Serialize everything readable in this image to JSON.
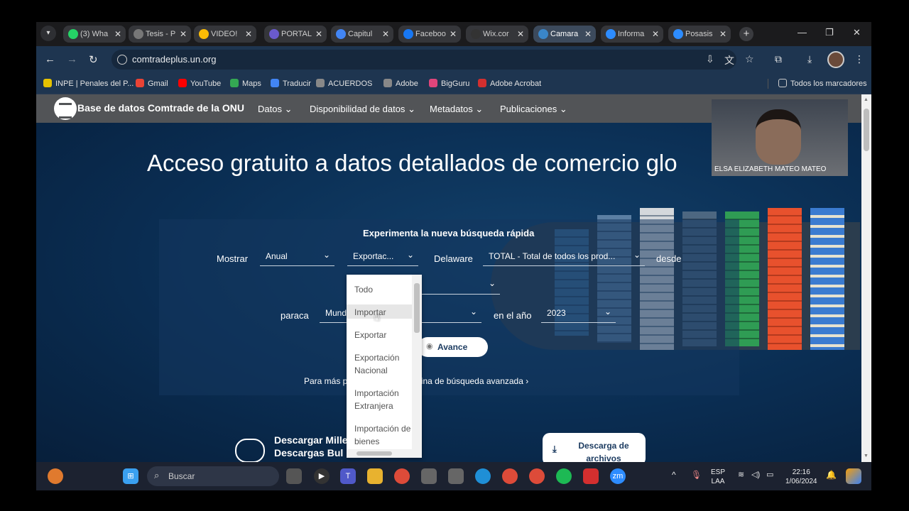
{
  "browser": {
    "tabs": [
      {
        "label": "(3) Wha",
        "icon": "whatsapp-icon",
        "color": "#25d366"
      },
      {
        "label": "Tesis - P",
        "icon": "globe-icon",
        "color": "#777777"
      },
      {
        "label": "VIDEO!",
        "icon": "drive-icon",
        "color": "#fbbc05"
      },
      {
        "label": "PORTAL",
        "icon": "play-icon",
        "color": "#6a5acd"
      },
      {
        "label": "Capitul",
        "icon": "docs-icon",
        "color": "#4285f4"
      },
      {
        "label": "Faceboo",
        "icon": "facebook-icon",
        "color": "#1877f2"
      },
      {
        "label": "Wix.cor",
        "icon": "wix-icon",
        "color": "#333333"
      },
      {
        "label": "Camara",
        "icon": "globe-icon",
        "color": "#3a86c8"
      },
      {
        "label": "Informa",
        "icon": "zoom-icon",
        "color": "#2d8cff"
      },
      {
        "label": "Posasis",
        "icon": "zoom-icon",
        "color": "#2d8cff"
      }
    ],
    "active_tab_index": 7,
    "url": "comtradeplus.un.org",
    "bookmarks": [
      {
        "label": "INPE | Penales del P...",
        "color": "#e6c200"
      },
      {
        "label": "Gmail",
        "color": "#ea4335"
      },
      {
        "label": "YouTube",
        "color": "#ff0000"
      },
      {
        "label": "Maps",
        "color": "#34a853"
      },
      {
        "label": "Traducir",
        "color": "#4285f4"
      },
      {
        "label": "ACUERDOS",
        "color": "#888888"
      },
      {
        "label": "Adobe",
        "color": "#888888"
      },
      {
        "label": "BigGuru",
        "color": "#e0457b"
      },
      {
        "label": "Adobe Acrobat",
        "color": "#d32f2f"
      }
    ],
    "all_bookmarks": "Todos los marcadores"
  },
  "site": {
    "name": "Base de datos Comtrade de la ONU",
    "nav": [
      "Datos",
      "Disponibilidad de datos",
      "Metadatos",
      "Publicaciones"
    ],
    "hero_title": "Acceso gratuito a datos detallados de comercio glo",
    "search": {
      "title": "Experimenta la nueva búsqueda rápida",
      "label_show": "Mostrar",
      "frequency": "Anual",
      "flow": "Exportac...",
      "reporter": "Delaware",
      "product": "TOTAL - Total de todos los prod...",
      "label_from": "desde",
      "label_to": "paraca",
      "partner": "Mund",
      "label_year": "en el año",
      "year": "2023",
      "advance_button": "Avance",
      "advanced_link": "Para más p          queda, vaya a Página de búsqueda avanzada ›"
    },
    "download_text_1": "Descargar Mille         os usando",
    "download_text_2": "Descargas Bul",
    "download_button": "Descarga de archivos"
  },
  "dropdown": {
    "items": [
      "Todo",
      "Importar",
      "Exportar",
      "Exportación Nacional",
      "Importación Extranjera",
      "Importación de bienes"
    ],
    "hover_index": 1
  },
  "webcam": {
    "name": "ELSA ELIZABETH MATEO MATEO"
  },
  "taskbar": {
    "search_placeholder": "Buscar",
    "lang_1": "ESP",
    "lang_2": "LAA",
    "time": "22:16",
    "date": "1/06/2024"
  }
}
